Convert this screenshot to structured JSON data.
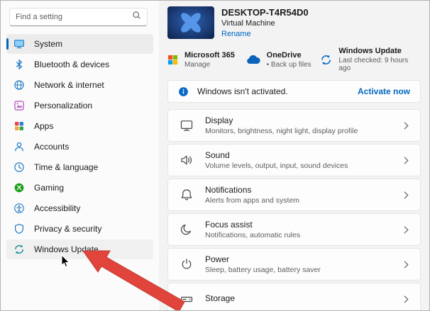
{
  "sidebar": {
    "search_placeholder": "Find a setting",
    "items": [
      {
        "label": "System",
        "selected": true
      },
      {
        "label": "Bluetooth & devices"
      },
      {
        "label": "Network & internet"
      },
      {
        "label": "Personalization"
      },
      {
        "label": "Apps"
      },
      {
        "label": "Accounts"
      },
      {
        "label": "Time & language"
      },
      {
        "label": "Gaming"
      },
      {
        "label": "Accessibility"
      },
      {
        "label": "Privacy & security"
      },
      {
        "label": "Windows Update",
        "hovered": true
      }
    ]
  },
  "header": {
    "device_name": "DESKTOP-T4R54D0",
    "device_type": "Virtual Machine",
    "rename_label": "Rename"
  },
  "quick_actions": [
    {
      "title": "Microsoft 365",
      "subtitle": "Manage"
    },
    {
      "title": "OneDrive",
      "subtitle": "• Back up files"
    },
    {
      "title": "Windows Update",
      "subtitle": "Last checked: 9 hours ago"
    }
  ],
  "banner": {
    "message": "Windows isn't activated.",
    "action_label": "Activate now"
  },
  "settings": [
    {
      "title": "Display",
      "subtitle": "Monitors, brightness, night light, display profile"
    },
    {
      "title": "Sound",
      "subtitle": "Volume levels, output, input, sound devices"
    },
    {
      "title": "Notifications",
      "subtitle": "Alerts from apps and system"
    },
    {
      "title": "Focus assist",
      "subtitle": "Notifications, automatic rules"
    },
    {
      "title": "Power",
      "subtitle": "Sleep, battery usage, battery saver"
    },
    {
      "title": "Storage",
      "subtitle": ""
    }
  ],
  "colors": {
    "accent": "#0067c0",
    "annotation_arrow": "#e0443a"
  }
}
